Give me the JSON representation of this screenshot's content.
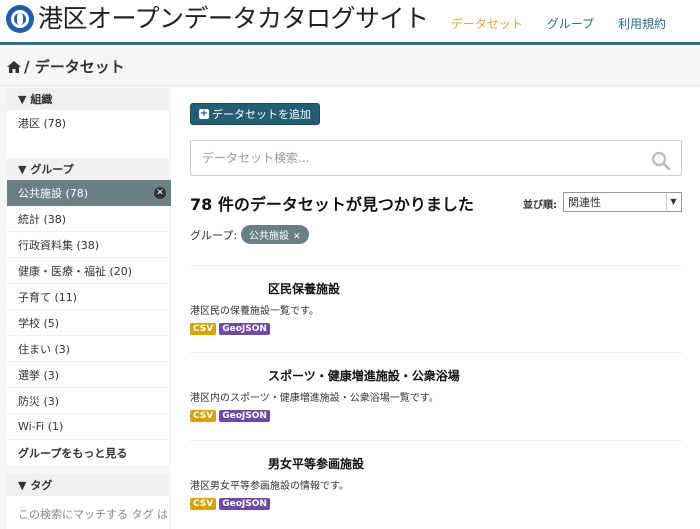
{
  "header": {
    "site_title": "港区オープンデータカタログサイト",
    "nav": [
      "データセット",
      "グループ",
      "利用規約"
    ]
  },
  "breadcrumb": {
    "text": "/ データセット"
  },
  "sidebar": {
    "org_heading": "組織",
    "org_items": [
      "港区 (78)"
    ],
    "group_heading": "グループ",
    "group_items": [
      "公共施設 (78)",
      "統計 (38)",
      "行政資料集 (38)",
      "健康・医療・福祉 (20)",
      "子育て (11)",
      "学校 (5)",
      "住まい (3)",
      "選挙 (3)",
      "防災 (3)",
      "Wi-Fi (1)"
    ],
    "more_groups": "グループをもっと見る",
    "tag_heading": "タグ",
    "tag_empty": "この検索にマッチする タグ は"
  },
  "main": {
    "add_button": "データセットを追加",
    "search_placeholder": "データセット検索...",
    "result_title": "78 件のデータセットが見つかりました",
    "sort_label": "並び順:",
    "sort_value": "関連性",
    "filter_label": "グループ:",
    "filter_pill": "公共施設"
  },
  "datasets": [
    {
      "title": "区民保養施設",
      "desc": "港区民の保養施設一覧です。",
      "tags": [
        "CSV",
        "GeoJSON"
      ]
    },
    {
      "title": "スポーツ・健康増進施設・公衆浴場",
      "desc": "港区内のスポーツ・健康増進施設・公衆浴場一覧です。",
      "tags": [
        "CSV",
        "GeoJSON"
      ]
    },
    {
      "title": "男女平等参画施設",
      "desc": "港区男女平等参画施設の情報です。",
      "tags": [
        "CSV",
        "GeoJSON"
      ]
    }
  ],
  "colors": {
    "accent": "#2b6f8c",
    "active_nav": "#e8a03a",
    "tag_csv": "#d9a200",
    "tag_geojson": "#6d4aa8"
  }
}
